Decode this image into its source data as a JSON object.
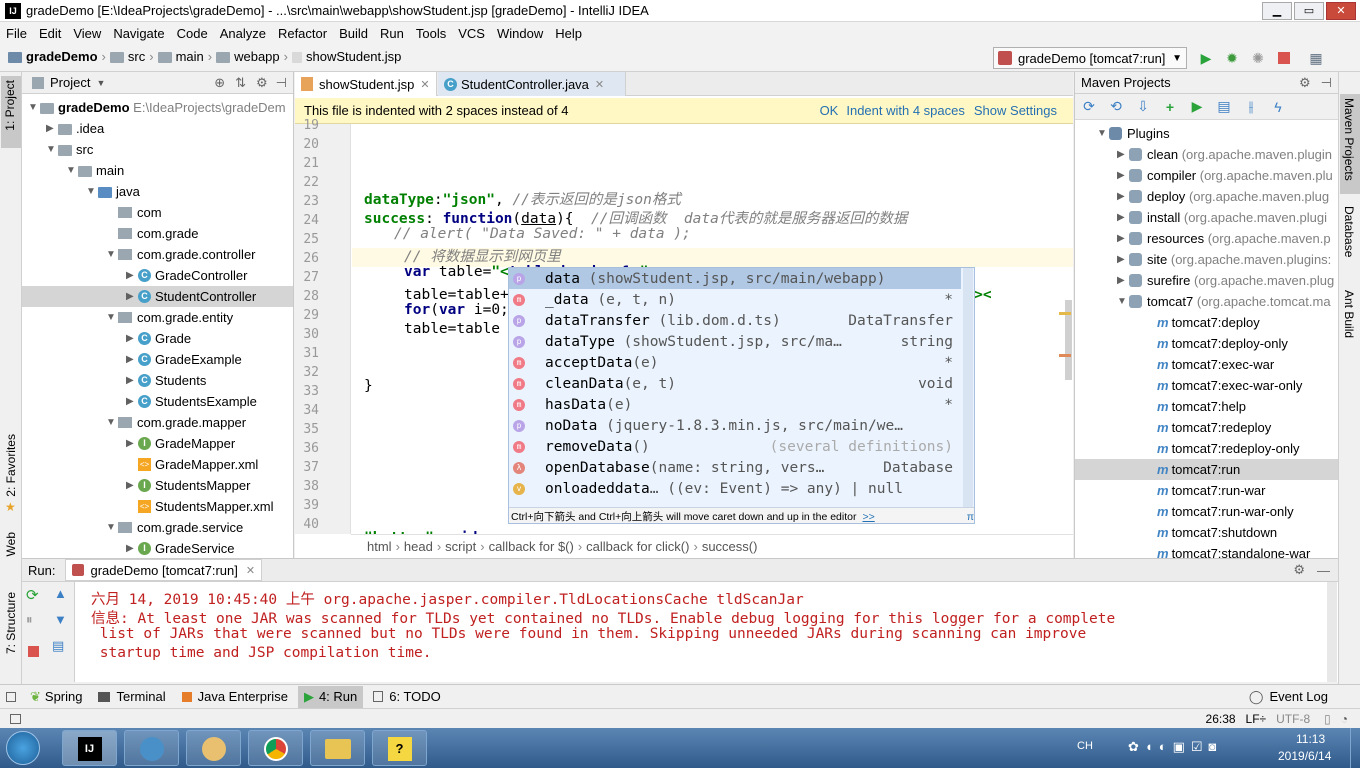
{
  "window": {
    "title": "gradeDemo [E:\\IdeaProjects\\gradeDemo] - ...\\src\\main\\webapp\\showStudent.jsp [gradeDemo] - IntelliJ IDEA"
  },
  "menu": [
    "File",
    "Edit",
    "View",
    "Navigate",
    "Code",
    "Analyze",
    "Refactor",
    "Build",
    "Run",
    "Tools",
    "VCS",
    "Window",
    "Help"
  ],
  "nav": {
    "crumbs": [
      "gradeDemo",
      "src",
      "main",
      "webapp",
      "showStudent.jsp"
    ],
    "run_config": "gradeDemo [tomcat7:run]"
  },
  "left_strip": {
    "project": "1: Project",
    "favorites": "2: Favorites",
    "web": "Web",
    "structure": "7: Structure"
  },
  "right_strip": {
    "maven": "Maven Projects",
    "database": "Database",
    "ant": "Ant Build"
  },
  "project": {
    "header": "Project",
    "tree": [
      {
        "label": "gradeDemo",
        "extra": "E:\\IdeaProjects\\gradeDem"
      },
      {
        "label": ".idea"
      },
      {
        "label": "src"
      },
      {
        "label": "main"
      },
      {
        "label": "java"
      },
      {
        "label": "com"
      },
      {
        "label": "com.grade"
      },
      {
        "label": "com.grade.controller"
      },
      {
        "label": "GradeController"
      },
      {
        "label": "StudentController"
      },
      {
        "label": "com.grade.entity"
      },
      {
        "label": "Grade"
      },
      {
        "label": "GradeExample"
      },
      {
        "label": "Students"
      },
      {
        "label": "StudentsExample"
      },
      {
        "label": "com.grade.mapper"
      },
      {
        "label": "GradeMapper"
      },
      {
        "label": "GradeMapper.xml"
      },
      {
        "label": "StudentsMapper"
      },
      {
        "label": "StudentsMapper.xml"
      },
      {
        "label": "com.grade.service"
      },
      {
        "label": "GradeService"
      }
    ]
  },
  "editor": {
    "tabs": [
      "showStudent.jsp",
      "StudentController.java"
    ],
    "banner": {
      "text": "This file is indented with 2 spaces instead of 4",
      "ok": "OK",
      "indent": "Indent with 4 spaces",
      "settings": "Show Settings"
    },
    "line_numbers": [
      "19",
      "20",
      "21",
      "22",
      "23",
      "24",
      "25",
      "26",
      "27",
      "28",
      "29",
      "30",
      "31",
      "32",
      "33",
      "34",
      "35",
      "36",
      "37",
      "38",
      "39",
      "40"
    ],
    "breadcrumbs": [
      "html",
      "head",
      "script",
      "callback for $()",
      "callback for click()",
      "success()"
    ]
  },
  "completion": {
    "items": [
      {
        "name": "data",
        "detail": "(showStudent.jsp, src/main/webapp)",
        "type": "",
        "kind": "p"
      },
      {
        "name": "_data",
        "detail": "(e, t, n)",
        "type": "*",
        "kind": "m"
      },
      {
        "name": "dataTransfer",
        "detail": "(lib.dom.d.ts)",
        "type": "DataTransfer",
        "kind": "p"
      },
      {
        "name": "dataType",
        "detail": "(showStudent.jsp, src/ma…",
        "type": "string",
        "kind": "p"
      },
      {
        "name": "acceptData",
        "detail": "(e)",
        "type": "*",
        "kind": "m"
      },
      {
        "name": "cleanData",
        "detail": "(e, t)",
        "type": "void",
        "kind": "m"
      },
      {
        "name": "hasData",
        "detail": "(e)",
        "type": "*",
        "kind": "m"
      },
      {
        "name": "noData",
        "detail": "(jquery-1.8.3.min.js, src/main/we…",
        "type": "",
        "kind": "p"
      },
      {
        "name": "removeData",
        "detail": "()",
        "type": "(several definitions)",
        "kind": "m"
      },
      {
        "name": "openDatabase",
        "detail": "(name: string, vers…",
        "type": "Database",
        "kind": "λ"
      },
      {
        "name": "onloadeddata",
        "detail": "… ((ev: Event) => any) | null",
        "type": "",
        "kind": "v"
      }
    ],
    "footer": "Ctrl+向下箭头 and Ctrl+向上箭头 will move caret down and up in the editor",
    "footer_link": ">>",
    "pi": "π"
  },
  "maven": {
    "header": "Maven Projects",
    "plugins_label": "Plugins",
    "plugins": [
      {
        "name": "clean",
        "group": "(org.apache.maven.plugin"
      },
      {
        "name": "compiler",
        "group": "(org.apache.maven.plu"
      },
      {
        "name": "deploy",
        "group": "(org.apache.maven.plug"
      },
      {
        "name": "install",
        "group": "(org.apache.maven.plugi"
      },
      {
        "name": "resources",
        "group": "(org.apache.maven.p"
      },
      {
        "name": "site",
        "group": "(org.apache.maven.plugins:"
      },
      {
        "name": "surefire",
        "group": "(org.apache.maven.plug"
      },
      {
        "name": "tomcat7",
        "group": "(org.apache.tomcat.ma"
      }
    ],
    "goals": [
      "tomcat7:deploy",
      "tomcat7:deploy-only",
      "tomcat7:exec-war",
      "tomcat7:exec-war-only",
      "tomcat7:help",
      "tomcat7:redeploy",
      "tomcat7:redeploy-only",
      "tomcat7:run",
      "tomcat7:run-war",
      "tomcat7:run-war-only",
      "tomcat7:shutdown",
      "tomcat7:standalone-war"
    ]
  },
  "run": {
    "label": "Run:",
    "tab": "gradeDemo [tomcat7:run]",
    "lines": [
      "六月 14, 2019 10:45:40 上午 org.apache.jasper.compiler.TldLocationsCache tldScanJar",
      "信息: At least one JAR was scanned for TLDs yet contained no TLDs. Enable debug logging for this logger for a complete",
      " list of JARs that were scanned but no TLDs were found in them. Skipping unneeded JARs during scanning can improve",
      " startup time and JSP compilation time."
    ]
  },
  "bottom_tools": [
    "Spring",
    "Terminal",
    "Java Enterprise",
    "4: Run",
    "6: TODO"
  ],
  "event_log": "Event Log",
  "status": {
    "position": "26:38",
    "line_sep": "LF÷",
    "encoding": "UTF-8"
  },
  "taskbar": {
    "lang": "CH",
    "time": "11:13",
    "date": "2019/6/14"
  }
}
